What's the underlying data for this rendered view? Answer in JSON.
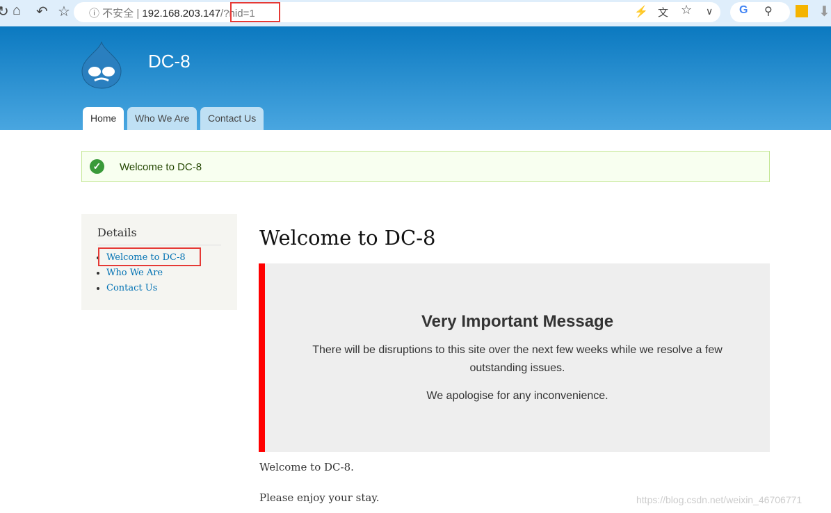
{
  "browser": {
    "security": "不安全",
    "url_host": "192.168.203.147",
    "url_query": "/?nid=1"
  },
  "site": {
    "name": "DC-8"
  },
  "nav": {
    "tabs": [
      {
        "label": "Home",
        "active": true
      },
      {
        "label": "Who We Are"
      },
      {
        "label": "Contact Us"
      }
    ]
  },
  "status": {
    "message": "Welcome to DC-8"
  },
  "sidebar": {
    "title": "Details",
    "items": [
      {
        "label": "Welcome to DC-8"
      },
      {
        "label": "Who We Are"
      },
      {
        "label": "Contact Us"
      }
    ]
  },
  "main": {
    "title": "Welcome to DC-8",
    "notice": {
      "heading": "Very Important Message",
      "p1": "There will be disruptions to this site over the next few weeks while we resolve a few outstanding issues.",
      "p2": "We apologise for any inconvenience."
    },
    "p1": "Welcome to DC-8.",
    "p2": "Please enjoy your stay."
  },
  "watermark": "https://blog.csdn.net/weixin_46706771",
  "colors": {
    "accent": "#0071b3",
    "notice_bar": "#ff0000"
  }
}
